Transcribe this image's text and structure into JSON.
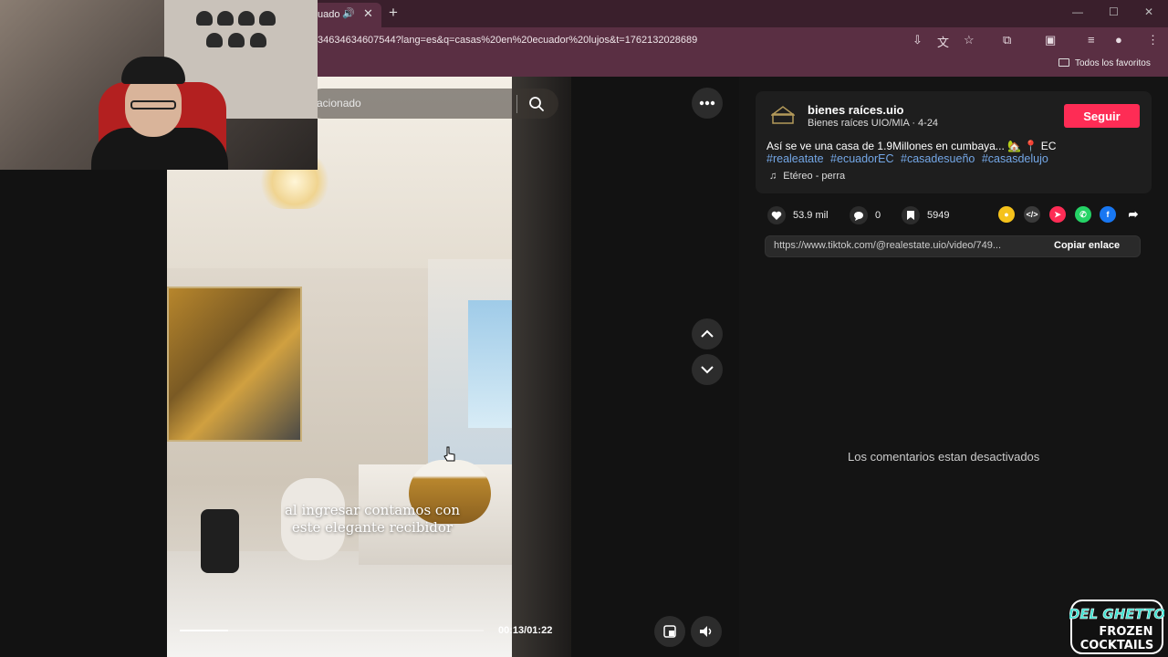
{
  "browser": {
    "tab_title": "uado",
    "tab_close": "✕",
    "new_tab": "+",
    "url": "34634634607544?lang=es&q=casas%20en%20ecuador%20lujos&t=1762132028689",
    "bookmark_folder": "Todos los favoritos"
  },
  "video": {
    "search_placeholder": "acionado",
    "caption": "al ingresar contamos con este elegante recibidor",
    "time": "00:13/01:22",
    "progress_fraction": 0.16
  },
  "post": {
    "account_name": "bienes raíces.uio",
    "account_sub": "Bienes raíces UIO/MIA · 4-24",
    "follow_label": "Seguir",
    "description": "Así se ve una casa de 1.9Millones en cumbaya... 🏡 📍 EC",
    "hashtags": [
      "#realeatate",
      "#ecuadorEC",
      "#casadesueño",
      "#casasdelujo"
    ],
    "music": "Etéreo - perra",
    "likes": "53.9 mil",
    "comments": "0",
    "saves": "5949",
    "link": "https://www.tiktok.com/@realestate.uio/video/749...",
    "copy_label": "Copiar enlace",
    "comments_disabled": "Los comentarios estan desactivados"
  },
  "logo": {
    "line1": "DEL GHETTO",
    "line2": "FROZEN",
    "line3": "COCKTAILS"
  },
  "colors": {
    "chrome": "#5a2f43",
    "follow": "#fe2c55",
    "hashtag": "#74a7e6"
  }
}
